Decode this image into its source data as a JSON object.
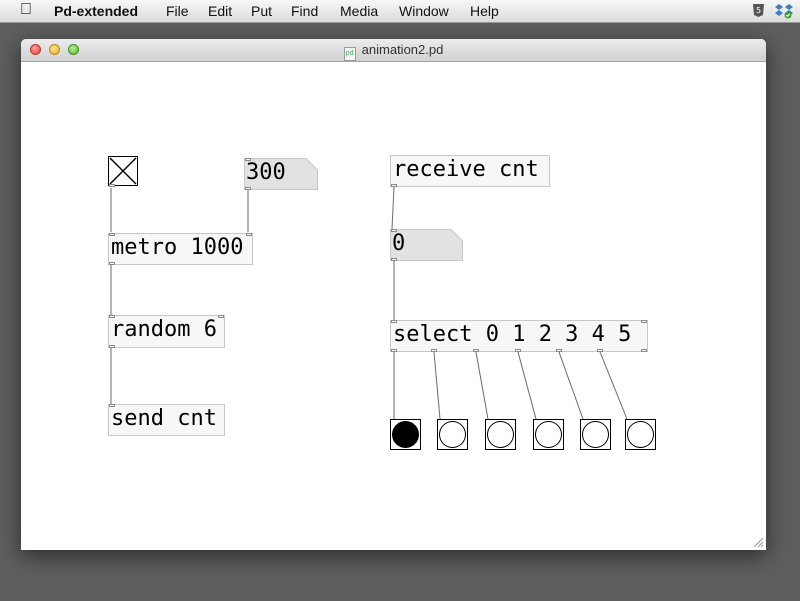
{
  "menubar": {
    "app_name": "Pd-extended",
    "items": [
      "File",
      "Edit",
      "Put",
      "Find",
      "Media",
      "Window",
      "Help"
    ],
    "apple_icon": "apple-icon",
    "tray_icons": [
      "html5-shield-icon",
      "dropbox-icon"
    ]
  },
  "window": {
    "title": "animation2.pd",
    "document_icon": "pd-document-icon"
  },
  "patch": {
    "metro_object": "metro 1000",
    "random_object": "random 6",
    "send_object": "send cnt",
    "receive_object": "receive cnt",
    "select_object": "select 0 1 2 3 4 5",
    "metro_interval_number": "300",
    "counter_number": "0",
    "toggle_checked": true,
    "bang_states": [
      true,
      false,
      false,
      false,
      false,
      false
    ]
  },
  "colors": {
    "object_box_fill": "#f7f7f7",
    "object_box_border": "#c8c8c8",
    "wire": "#6b6b6b",
    "number_box_fill": "#e2e2e2",
    "bang_active": "#000000"
  }
}
